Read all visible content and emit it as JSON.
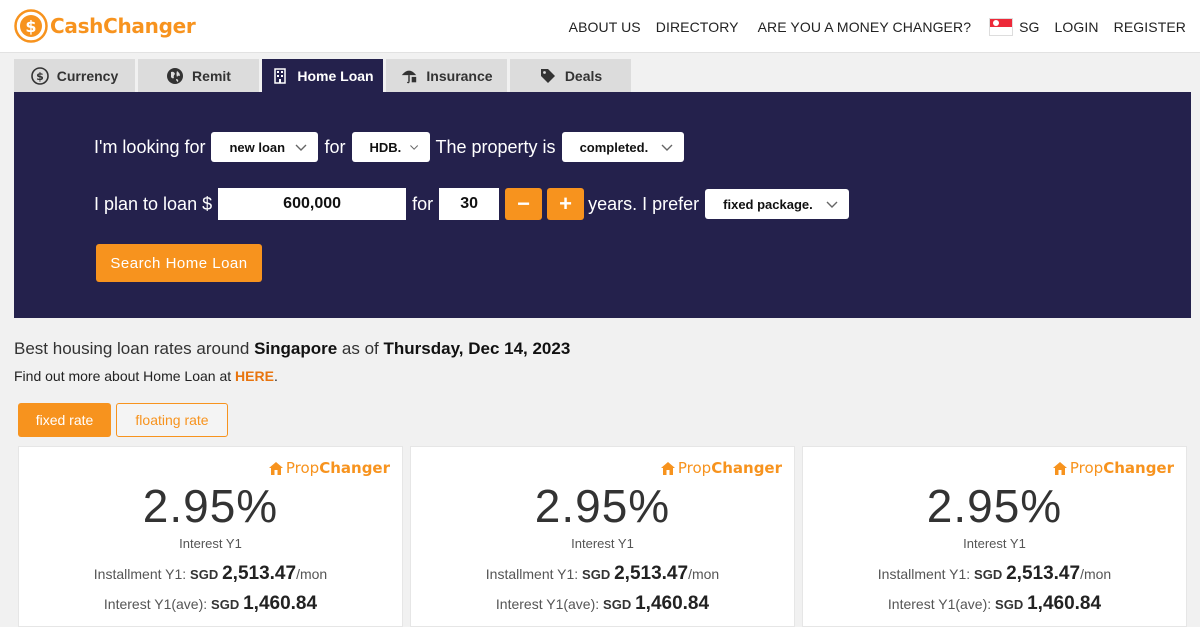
{
  "brand": {
    "logo_text": "CashChanger"
  },
  "nav": {
    "about": "ABOUT US",
    "directory": "DIRECTORY",
    "money_changer": "ARE YOU A MONEY CHANGER?",
    "country": "SG",
    "login": "LOGIN",
    "register": "REGISTER"
  },
  "tabs": [
    {
      "label": "Currency",
      "icon": "dollar-circle-icon"
    },
    {
      "label": "Remit",
      "icon": "globe-icon"
    },
    {
      "label": "Home Loan",
      "icon": "building-icon",
      "active": true
    },
    {
      "label": "Insurance",
      "icon": "umbrella-icon"
    },
    {
      "label": "Deals",
      "icon": "tag-icon"
    }
  ],
  "form": {
    "looking_for": "I'm looking for",
    "loan_type": "new loan",
    "for1": "for",
    "property_type": "HDB.",
    "property_is": "The property is",
    "property_status": "completed.",
    "plan_to_loan": "I plan to loan $",
    "amount": "600,000",
    "for2": "for",
    "years": "30",
    "minus": "−",
    "plus": "+",
    "years_prefer": "years. I prefer",
    "package": "fixed package.",
    "search_button": "Search Home Loan"
  },
  "info": {
    "line1_prefix": "Best housing loan rates around",
    "location": "Singapore",
    "as_of": "as of",
    "date": "Thursday, Dec 14, 2023",
    "line2_prefix": "Find out more about Home Loan at",
    "here": "HERE",
    "period": "."
  },
  "rate_toggle": {
    "fixed": "fixed rate",
    "floating": "floating rate"
  },
  "cards": [
    {
      "brand_prop": "Prop",
      "brand_changer": "Changer",
      "rate": "2.95%",
      "rate_label": "Interest Y1",
      "inst_label": "Installment Y1:",
      "currency": "SGD",
      "inst_amount": "2,513.47",
      "per": "/mon",
      "ave_label": "Interest Y1(ave):",
      "ave_amount": "1,460.84"
    },
    {
      "brand_prop": "Prop",
      "brand_changer": "Changer",
      "rate": "2.95%",
      "rate_label": "Interest Y1",
      "inst_label": "Installment Y1:",
      "currency": "SGD",
      "inst_amount": "2,513.47",
      "per": "/mon",
      "ave_label": "Interest Y1(ave):",
      "ave_amount": "1,460.84"
    },
    {
      "brand_prop": "Prop",
      "brand_changer": "Changer",
      "rate": "2.95%",
      "rate_label": "Interest Y1",
      "inst_label": "Installment Y1:",
      "currency": "SGD",
      "inst_amount": "2,513.47",
      "per": "/mon",
      "ave_label": "Interest Y1(ave):",
      "ave_amount": "1,460.84"
    }
  ],
  "colors": {
    "accent": "#f7931e",
    "panel": "#24214c"
  }
}
